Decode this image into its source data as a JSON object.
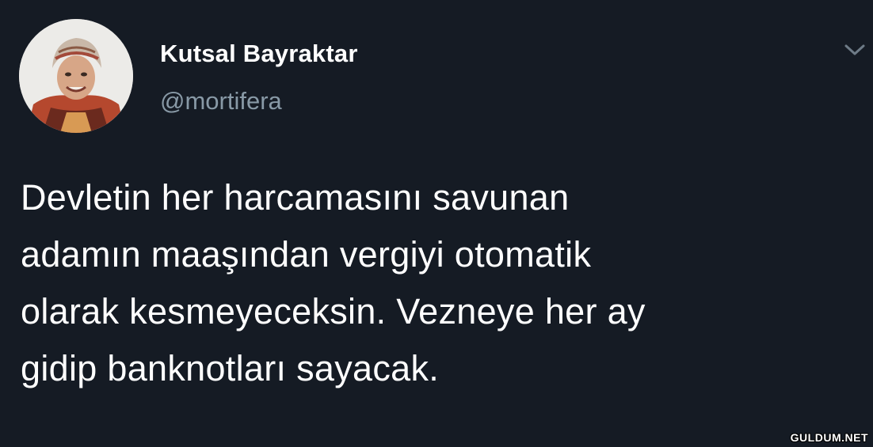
{
  "user": {
    "display_name": "Kutsal Bayraktar",
    "handle": "@mortifera"
  },
  "icons": {
    "menu": "chevron-down-icon",
    "avatar": "profile-photo"
  },
  "tweet": {
    "lines": [
      "Devletin her harcamasını savunan",
      "adamın maaşından vergiyi otomatik",
      "olarak kesmeyeceksin. Vezneye her ay",
      "gidip banknotları sayacak."
    ]
  },
  "watermark": "GULDUM.NET",
  "colors": {
    "background": "#151b24",
    "name": "#ffffff",
    "handle": "#8899a6",
    "text": "#ffffff"
  }
}
